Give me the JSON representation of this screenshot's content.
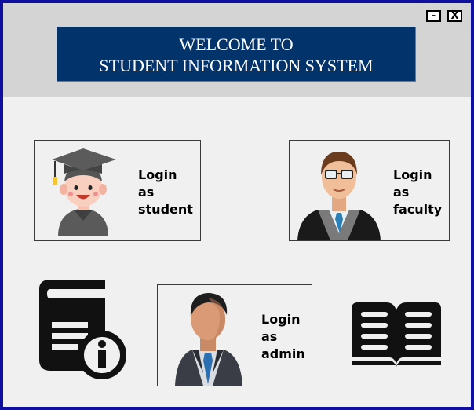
{
  "window": {
    "title_line1": "WELCOME TO",
    "title_line2": "STUDENT INFORMATION SYSTEM",
    "minimize_label": "-",
    "close_label": "X"
  },
  "cards": {
    "student": {
      "line1": "Login",
      "line2": "as",
      "line3": "student",
      "icon": "student-graduate-avatar"
    },
    "faculty": {
      "line1": "Login",
      "line2": "as",
      "line3": "faculty",
      "icon": "faculty-teacher-avatar"
    },
    "admin": {
      "line1": "Login",
      "line2": "as",
      "line3": "admin",
      "icon": "admin-businessman-avatar"
    }
  },
  "icons": {
    "info": "information-book-icon",
    "book": "open-book-icon"
  },
  "colors": {
    "border": "#0f10a0",
    "title_bg": "#03336b",
    "header_bg": "#d4d4d4",
    "body_bg": "#f0f0f0"
  }
}
